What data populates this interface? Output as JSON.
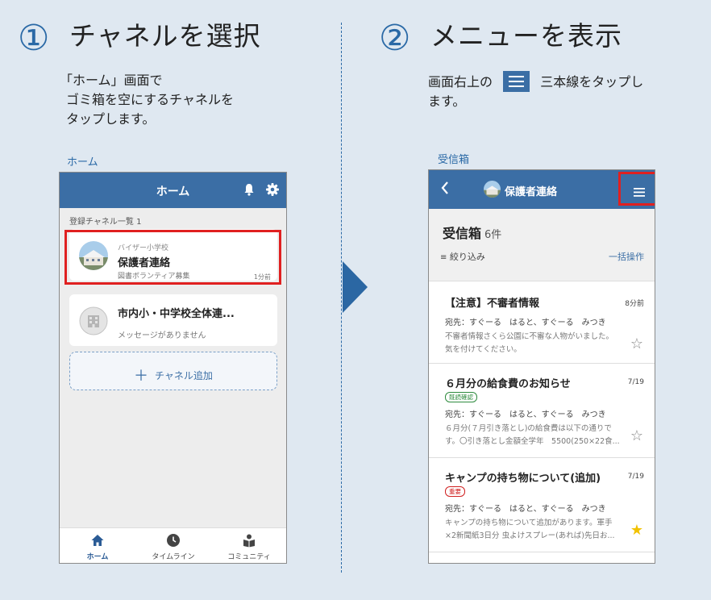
{
  "step1": {
    "number": "①",
    "title": "チャネルを選択",
    "desc_lines": [
      "「ホーム」画面で",
      "ゴミ箱を空にするチャネルを",
      "タップします。"
    ],
    "caption": "ホーム"
  },
  "step2": {
    "number": "②",
    "title": "メニューを表示",
    "desc_line1_before": "画面右上の",
    "desc_line1_after": "三本線をタップし",
    "desc_line2": "ます。",
    "caption": "受信箱"
  },
  "phone1": {
    "header_title": "ホーム",
    "section_label": "登録チャネル一覧 1",
    "channels": [
      {
        "school": "バイザー小学校",
        "name": "保護者連絡",
        "sub": "図書ボランティア募集",
        "time": "1分前"
      },
      {
        "name": "市内小・中学校全体連...",
        "sub": "メッセージがありません"
      }
    ],
    "add_label": "チャネル追加",
    "tabs": [
      {
        "label": "ホーム",
        "icon": "home-icon"
      },
      {
        "label": "タイムライン",
        "icon": "clock-icon"
      },
      {
        "label": "コミュニティ",
        "icon": "community-icon"
      }
    ]
  },
  "phone2": {
    "header_title": "保護者連絡",
    "inbox_title": "受信箱",
    "inbox_count": "6件",
    "filter_label": "絞り込み",
    "bulk_label": "一括操作",
    "messages": [
      {
        "title": "【注意】不審者情報",
        "date": "8分前",
        "to": "宛先：すぐーる　はると、すぐーる　みつき",
        "body1": "不審者情報さくら公園に不審な人物がいました。",
        "body2": "気を付けてください。",
        "starred": false
      },
      {
        "title": "６月分の給食費のお知らせ",
        "date": "7/19",
        "tag": "既読確認",
        "to": "宛先：すぐーる　はると、すぐーる　みつき",
        "body1": "６月分(７月引き落とし)の給食費は以下の通りで",
        "body2": "す。〇引き落とし金額全学年　5500(250×22食...",
        "starred": false
      },
      {
        "title": "キャンプの持ち物について(追加)",
        "date": "7/19",
        "tag": "重要",
        "to": "宛先：すぐーる　はると、すぐーる　みつき",
        "body1": "キャンプの持ち物について追加があります。軍手",
        "body2": "×2新聞紙3日分 虫よけスプレー(あれば)先日お...",
        "starred": true
      }
    ]
  },
  "colors": {
    "accent": "#3b6ea5",
    "highlight": "#e02020",
    "star": "#f2c200"
  }
}
